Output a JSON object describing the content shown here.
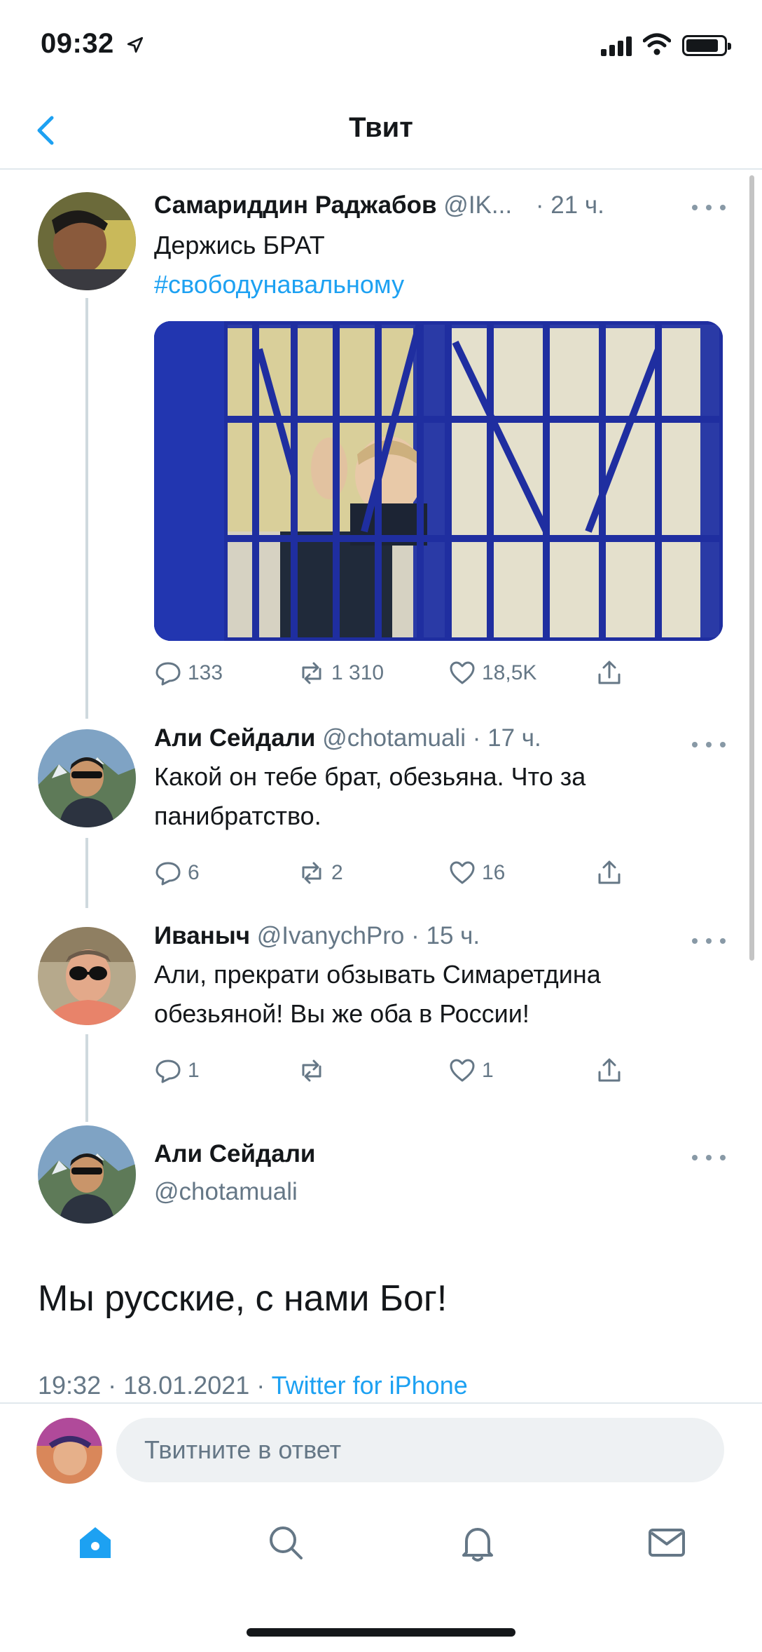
{
  "status": {
    "time": "09:32",
    "location_icon": "location-arrow-icon",
    "signal_icon": "cellular-signal-icon",
    "wifi_icon": "wifi-icon",
    "battery_icon": "battery-icon"
  },
  "nav": {
    "back_icon": "chevron-left-icon",
    "title": "Твит"
  },
  "tweets": [
    {
      "name": "Самариддин Раджабов",
      "handle": "@IK...",
      "time": "· 21 ч.",
      "text": "Держись БРАТ",
      "hashtag": "#свободунавальному",
      "photo_alt": "image",
      "replies": "133",
      "retweets": "1 310",
      "likes": "18,5K"
    },
    {
      "name": "Али Сейдали",
      "handle": "@chotamuali",
      "time": "· 17 ч.",
      "text_line1": "Какой он тебе брат, обезьяна. Что за",
      "text_line2": "панибратство.",
      "replies": "6",
      "retweets": "2",
      "likes": "16"
    },
    {
      "name": "Иваныч",
      "handle": "@IvanychPro",
      "time": "· 15 ч.",
      "text_line1": "Али, прекрати обзывать Симаретдина",
      "text_line2": "обезьяной! Вы же оба в России!",
      "replies": "1",
      "retweets": "",
      "likes": "1"
    }
  ],
  "main_tweet": {
    "name": "Али Сейдали",
    "handle": "@chotamuali",
    "text": "Мы русские, с нами Бог!",
    "timestamp": "19:32 · 18.01.2021 · ",
    "via": "Twitter for iPhone"
  },
  "reply_bar": {
    "placeholder": "Твитните в ответ"
  },
  "tabbar": {
    "icons": [
      "home-icon",
      "search-icon",
      "notifications-bell-icon",
      "messages-envelope-icon"
    ]
  },
  "colors": {
    "accent": "#1da1f2",
    "secondary_text": "#657786",
    "divider": "#e1e8ed"
  }
}
